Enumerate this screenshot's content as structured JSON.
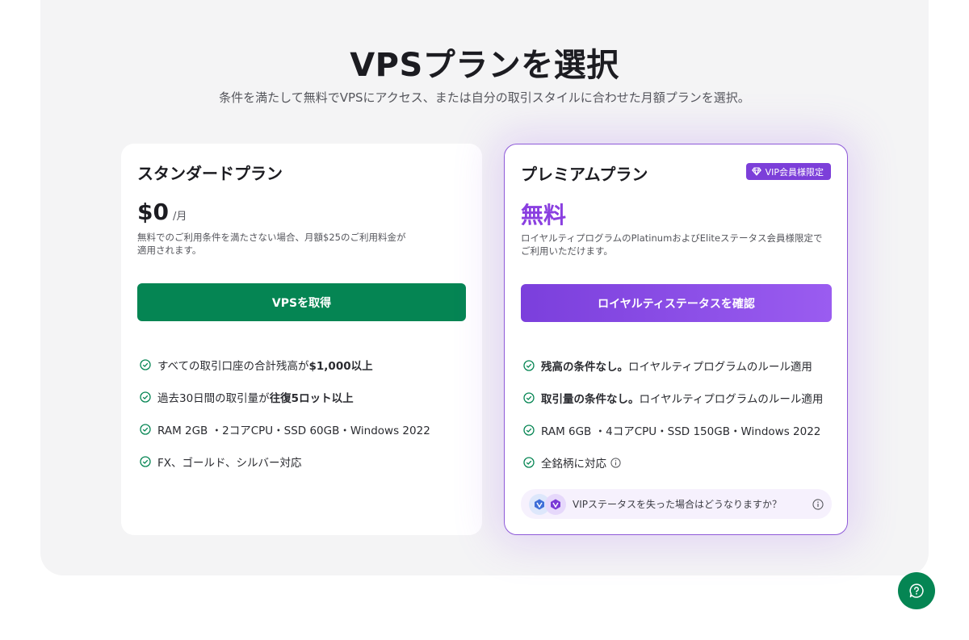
{
  "header": {
    "title": "VPSプランを選択",
    "subtitle": "条件を満たして無料でVPSにアクセス、または自分の取引スタイルに合わせた月額プランを選択。"
  },
  "standard_plan": {
    "title": "スタンダードプラン",
    "price": "$0",
    "price_unit": "/月",
    "desc_line1": "無料でのご利用条件を満たさない場合、月額$25のご利用料金が",
    "desc_line2": "適用されます。",
    "cta_label": "VPSを取得",
    "features": [
      {
        "pre": "すべての取引口座の合計残高が",
        "bold": "$1,000以上",
        "post": ""
      },
      {
        "pre": "過去30日間の取引量が",
        "bold": "往復5ロット以上",
        "post": ""
      },
      {
        "pre": "RAM 2GB ・2コアCPU・SSD 60GB・Windows 2022",
        "bold": "",
        "post": ""
      },
      {
        "pre": "FX、ゴールド、シルバー対応",
        "bold": "",
        "post": ""
      }
    ]
  },
  "premium_plan": {
    "title": "プレミアムプラン",
    "badge": "VIP会員様限定",
    "price": "無料",
    "desc_line1": "ロイヤルティプログラムのPlatinumおよびEliteステータス会員様限定で",
    "desc_line2": "ご利用いただけます。",
    "cta_label": "ロイヤルティステータスを確認",
    "features": [
      {
        "bold": "残高の条件なし。",
        "post": " ロイヤルティプログラムのルール適用"
      },
      {
        "bold": "取引量の条件なし。",
        "post": " ロイヤルティプログラムのルール適用"
      },
      {
        "bold": "",
        "post": "RAM 6GB ・4コアCPU・SSD 150GB・Windows 2022"
      },
      {
        "bold": "",
        "post": "全銘柄に対応"
      }
    ],
    "vip_question": "VIPステータスを失った場合はどうなりますか？"
  },
  "colors": {
    "brand_green": "#058553",
    "premium_purple": "#7c3fd9",
    "check_green": "#058553"
  },
  "icons": [
    "check-circle-icon",
    "diamond-icon",
    "info-icon",
    "platinum-tier-icon",
    "elite-tier-icon",
    "help-chat-icon"
  ]
}
